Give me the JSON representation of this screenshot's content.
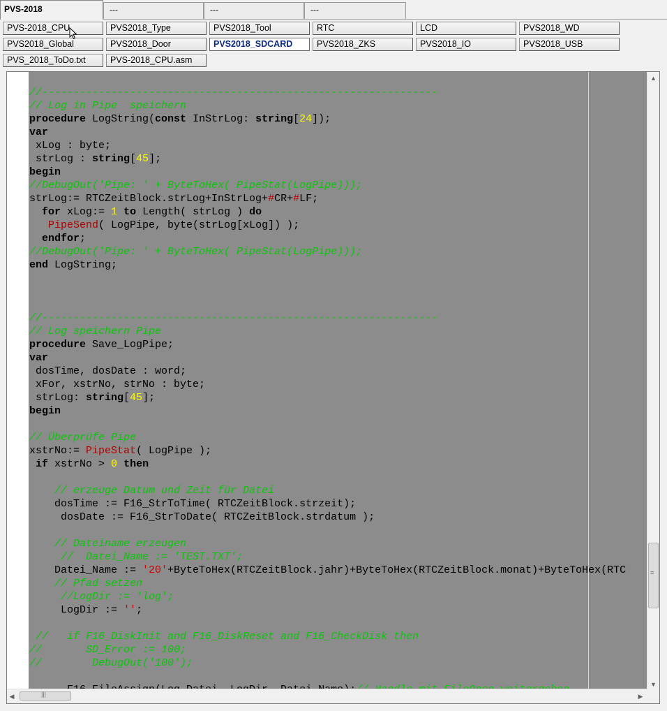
{
  "tabs": [
    {
      "label": "PVS-2018",
      "active": true
    },
    {
      "label": "---"
    },
    {
      "label": "---"
    },
    {
      "label": "---"
    }
  ],
  "file_buttons": [
    "PVS-2018_CPU",
    "PVS2018_Type",
    "PVS2018_Tool",
    "RTC",
    "LCD",
    "PVS2018_WD",
    "PVS2018_Global",
    "PVS2018_Door",
    "PVS2018_SDCARD",
    "PVS2018_ZKS",
    "PVS2018_IO",
    "PVS2018_USB",
    "PVS_2018_ToDo.txt",
    "PVS-2018_CPU.asm"
  ],
  "active_file": "PVS2018_SDCARD",
  "colors": {
    "editor_bg": "#8c8c8c",
    "comment": "#0ac60a",
    "number": "#ffff00",
    "proc_call": "#b00000",
    "string": "#d00000",
    "active_button_text": "#0b2a80"
  },
  "code_lines": [
    [
      [
        "//---------------------------------------------------------------",
        "cm"
      ]
    ],
    [
      [
        "// Log in Pipe  speichern",
        "cm"
      ]
    ],
    [
      [
        "procedure",
        "kw"
      ],
      [
        " LogString(",
        ""
      ],
      [
        "const",
        "kw"
      ],
      [
        " InStrLog: ",
        ""
      ],
      [
        "string",
        "kw"
      ],
      [
        "[",
        ""
      ],
      [
        "24",
        "num"
      ],
      [
        "]);",
        ""
      ]
    ],
    [
      [
        "var",
        "kw"
      ]
    ],
    [
      [
        " xLog : byte;",
        ""
      ]
    ],
    [
      [
        " strLog : ",
        ""
      ],
      [
        "string",
        "kw"
      ],
      [
        "[",
        ""
      ],
      [
        "45",
        "num"
      ],
      [
        "];",
        ""
      ]
    ],
    [
      [
        "begin",
        "kw"
      ]
    ],
    [
      [
        "//DebugOut('Pipe: ' + ByteToHex( PipeStat(LogPipe)));",
        "cm"
      ]
    ],
    [
      [
        "strLog:= RTCZeitBlock.strLog+InStrLog+",
        ""
      ],
      [
        "#",
        "sym"
      ],
      [
        "CR+",
        ""
      ],
      [
        "#",
        "sym"
      ],
      [
        "LF;",
        ""
      ]
    ],
    [
      [
        "  ",
        ""
      ],
      [
        "for",
        "kw"
      ],
      [
        " xLog:= ",
        ""
      ],
      [
        "1",
        "num"
      ],
      [
        " ",
        ""
      ],
      [
        "to",
        "kw"
      ],
      [
        " Length( strLog ) ",
        ""
      ],
      [
        "do",
        "kw"
      ]
    ],
    [
      [
        "   ",
        ""
      ],
      [
        "PipeSend",
        "fn"
      ],
      [
        "( LogPipe, byte(strLog[xLog]) );",
        ""
      ]
    ],
    [
      [
        "  ",
        ""
      ],
      [
        "endfor",
        "kw"
      ],
      [
        ";",
        ""
      ]
    ],
    [
      [
        "//DebugOut('Pipe: ' + ByteToHex( PipeStat(LogPipe)));",
        "cm"
      ]
    ],
    [
      [
        "end",
        "kw"
      ],
      [
        " LogString;",
        ""
      ]
    ],
    [],
    [],
    [],
    [
      [
        "//---------------------------------------------------------------",
        "cm"
      ]
    ],
    [
      [
        "// Log speichern Pipe",
        "cm"
      ]
    ],
    [
      [
        "procedure",
        "kw"
      ],
      [
        " Save_LogPipe;",
        ""
      ]
    ],
    [
      [
        "var",
        "kw"
      ]
    ],
    [
      [
        " dosTime, dosDate : word;",
        ""
      ]
    ],
    [
      [
        " xFor, xstrNo, strNo : byte;",
        ""
      ]
    ],
    [
      [
        " strLog: ",
        ""
      ],
      [
        "string",
        "kw"
      ],
      [
        "[",
        ""
      ],
      [
        "45",
        "num"
      ],
      [
        "];",
        ""
      ]
    ],
    [
      [
        "begin",
        "kw"
      ]
    ],
    [],
    [
      [
        "// Überprüfe Pipe",
        "cm"
      ]
    ],
    [
      [
        "xstrNo:= ",
        ""
      ],
      [
        "PipeStat",
        "fn"
      ],
      [
        "( LogPipe );",
        ""
      ]
    ],
    [
      [
        " ",
        ""
      ],
      [
        "if",
        "kw"
      ],
      [
        " xstrNo > ",
        ""
      ],
      [
        "0",
        "num"
      ],
      [
        " ",
        ""
      ],
      [
        "then",
        "kw"
      ]
    ],
    [],
    [
      [
        "    ",
        ""
      ],
      [
        "// erzeuge Datum und Zeit für Datei",
        "cm"
      ]
    ],
    [
      [
        "    dosTime := F16_StrToTime( RTCZeitBlock.strzeit);",
        ""
      ]
    ],
    [
      [
        "     dosDate := F16_StrToDate( RTCZeitBlock.strdatum );",
        ""
      ]
    ],
    [],
    [
      [
        "    ",
        ""
      ],
      [
        "// Dateiname erzeugen",
        "cm"
      ]
    ],
    [
      [
        "     ",
        ""
      ],
      [
        "//  Datei_Name := 'TEST.TXT';",
        "cm"
      ]
    ],
    [
      [
        "    Datei_Name := ",
        ""
      ],
      [
        "'20'",
        "str"
      ],
      [
        "+ByteToHex(RTCZeitBlock.jahr)+ByteToHex(RTCZeitBlock.monat)+ByteToHex(RTC",
        ""
      ]
    ],
    [
      [
        "    ",
        ""
      ],
      [
        "// Pfad setzen",
        "cm"
      ]
    ],
    [
      [
        "     ",
        ""
      ],
      [
        "//LogDir := 'log';",
        "cm"
      ]
    ],
    [
      [
        "     LogDir := ",
        ""
      ],
      [
        "''",
        "str"
      ],
      [
        ";",
        ""
      ]
    ],
    [],
    [
      [
        " ",
        ""
      ],
      [
        "//   if F16_DiskInit and F16_DiskReset and F16_CheckDisk then",
        "cm"
      ]
    ],
    [
      [
        "//       SD_Error := 100;",
        "cm"
      ]
    ],
    [
      [
        "//        DebugOut('100');",
        "cm"
      ]
    ],
    [],
    [
      [
        "      F16_FileAssign(Log_Datei, LogDir, Datei_Name);",
        ""
      ],
      [
        "// Handle mit FileOpen weitergeben",
        "cm"
      ]
    ]
  ]
}
